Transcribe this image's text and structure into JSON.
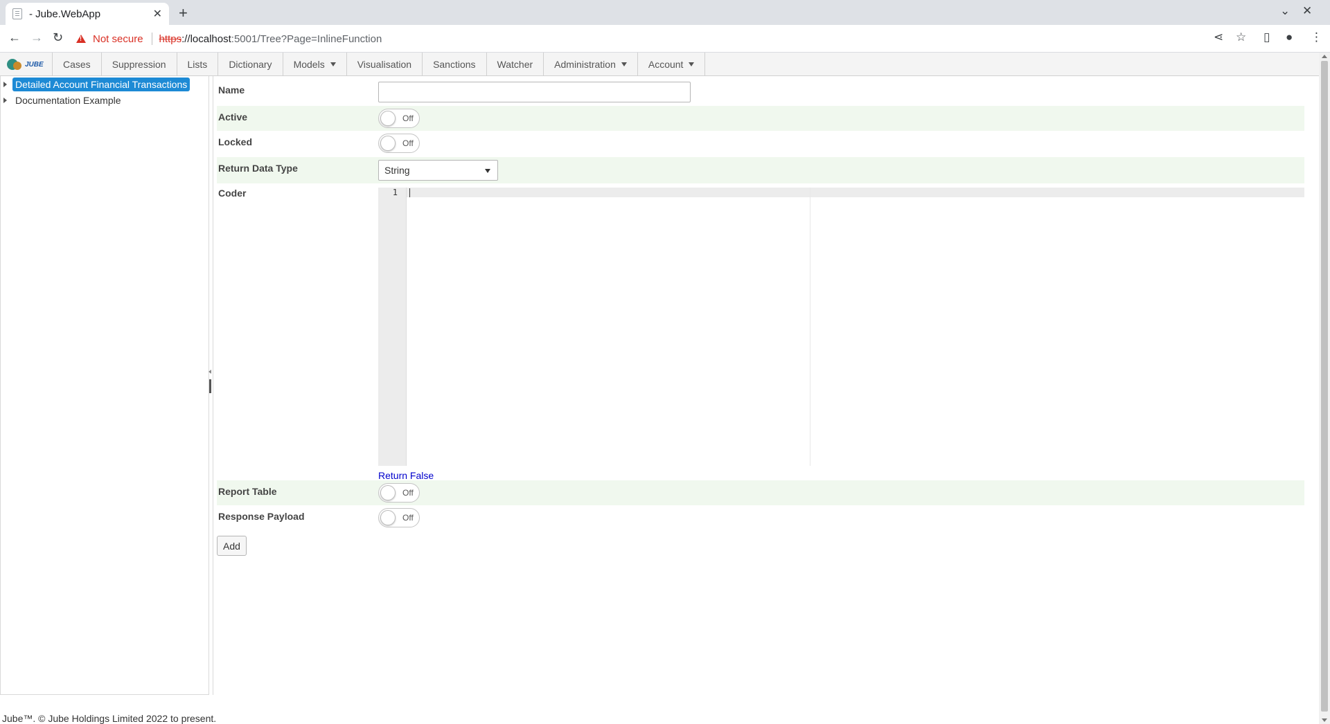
{
  "browser": {
    "tab_title": "- Jube.WebApp",
    "not_secure": "Not secure",
    "url_scheme": "https",
    "url_host": "://localhost",
    "url_path": ":5001/Tree?Page=InlineFunction"
  },
  "nav": {
    "items": [
      {
        "label": "Cases"
      },
      {
        "label": "Suppression"
      },
      {
        "label": "Lists"
      },
      {
        "label": "Dictionary"
      },
      {
        "label": "Models"
      },
      {
        "label": "Visualisation"
      },
      {
        "label": "Sanctions"
      },
      {
        "label": "Watcher"
      },
      {
        "label": "Administration"
      },
      {
        "label": "Account"
      }
    ]
  },
  "tree": {
    "nodes": [
      {
        "label": "Detailed Account Financial Transactions",
        "selected": true
      },
      {
        "label": "Documentation Example",
        "selected": false
      }
    ]
  },
  "form": {
    "name_label": "Name",
    "name_value": "",
    "active_label": "Active",
    "active_state": "Off",
    "locked_label": "Locked",
    "locked_state": "Off",
    "return_type_label": "Return Data Type",
    "return_type_value": "String",
    "coder_label": "Coder",
    "coder_line": "1",
    "return_link": "Return False",
    "report_table_label": "Report Table",
    "report_table_state": "Off",
    "response_payload_label": "Response Payload",
    "response_payload_state": "Off",
    "add_button": "Add"
  },
  "footer": {
    "text": "Jube™. © Jube Holdings Limited 2022 to present."
  },
  "colors": {
    "selected_tree": "#1d8ad5",
    "alt_row": "#f0f8ee",
    "link": "#0000cc"
  }
}
